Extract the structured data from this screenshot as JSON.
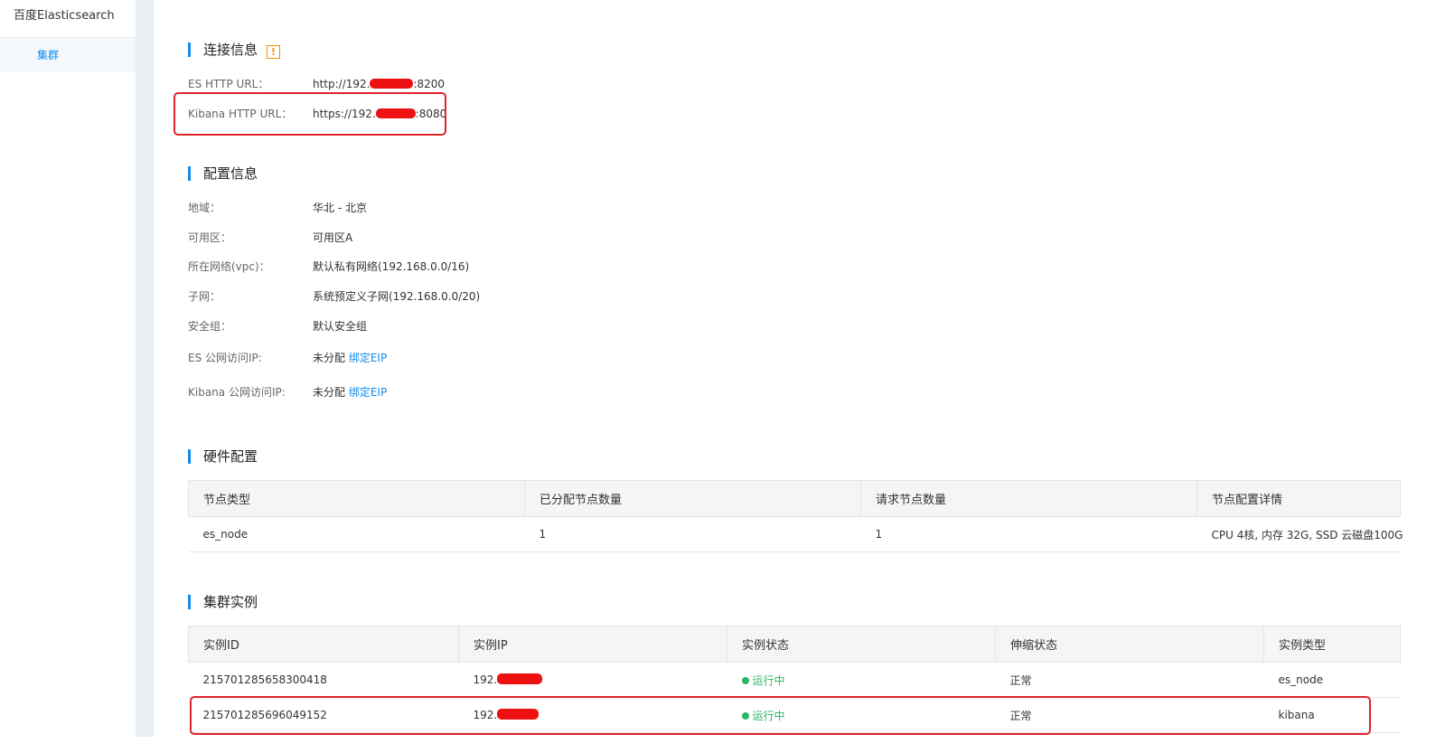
{
  "sidebar": {
    "title": "百度Elasticsearch",
    "items": [
      {
        "label": "集群",
        "active": true
      }
    ]
  },
  "connection": {
    "title": "连接信息",
    "warn_icon": "!",
    "es_url_label": "ES HTTP URL：",
    "es_url_prefix": "http://192.",
    "es_url_suffix": ":8200",
    "kibana_url_label": "Kibana HTTP URL：",
    "kibana_url_prefix": "https://192.",
    "kibana_url_suffix": ":8080"
  },
  "config": {
    "title": "配置信息",
    "region_label": "地域：",
    "region_value": "华北 - 北京",
    "zone_label": "可用区：",
    "zone_value": "可用区A",
    "vpc_label": "所在网络(vpc)：",
    "vpc_value": "默认私有网络(192.168.0.0/16)",
    "subnet_label": "子网：",
    "subnet_value": "系统预定义子网(192.168.0.0/20)",
    "secgroup_label": "安全组：",
    "secgroup_value": "默认安全组",
    "es_eip_label": "ES 公网访问IP:",
    "es_eip_value": "未分配",
    "es_eip_link": "绑定EIP",
    "kibana_eip_label": "Kibana 公网访问IP:",
    "kibana_eip_value": "未分配",
    "kibana_eip_link": "绑定EIP"
  },
  "hardware": {
    "title": "硬件配置",
    "columns": [
      "节点类型",
      "已分配节点数量",
      "请求节点数量",
      "节点配置详情"
    ],
    "rows": [
      [
        "es_node",
        "1",
        "1",
        "CPU 4核, 内存 32G, SSD 云磁盘100G"
      ]
    ]
  },
  "instances": {
    "title": "集群实例",
    "columns": [
      "实例ID",
      "实例IP",
      "实例状态",
      "伸缩状态",
      "实例类型"
    ],
    "rows": [
      {
        "id": "215701285658300418",
        "ip_prefix": "192.",
        "status": "运行中",
        "scale": "正常",
        "type": "es_node"
      },
      {
        "id": "215701285696049152",
        "ip_prefix": "192.",
        "status": "运行中",
        "scale": "正常",
        "type": "kibana"
      }
    ]
  },
  "colors": {
    "accent": "#108cee",
    "highlight_box": "#e0242b",
    "redaction": "#ee1111",
    "status_ok": "#2cb663",
    "warning": "#f39000"
  }
}
